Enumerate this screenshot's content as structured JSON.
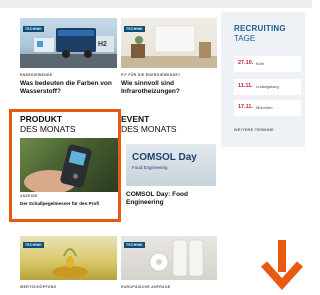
{
  "cards_top": [
    {
      "tag": "TECHNIK",
      "category": "ENERGIEWENDE",
      "title": "Was bedeuten die Farben von Wasserstoff?"
    },
    {
      "tag": "TECHNIK",
      "category": "FIT FÜR DIE ENERGIEWENDE?",
      "title": "Wie sinnvoll sind Infrarotheizungen?"
    }
  ],
  "produkt": {
    "heading": "PRODUKT",
    "subheading": "DES MONATS",
    "category": "ANZEIGE",
    "title": "Der Schallpegelmesser für den Profi"
  },
  "event": {
    "heading": "EVENT",
    "subheading": "DES MONATS",
    "banner_brand": "COMSOL Day",
    "banner_sub": "Food Engineering",
    "title": "COMSOL Day: Food Engineering"
  },
  "cards_bottom": [
    {
      "tag": "TECHNIK",
      "category": "WERTSCHÖPFUNG"
    },
    {
      "tag": "TECHNIK",
      "category": "EUROPÄISCHE ANFRAGE"
    }
  ],
  "recruiting": {
    "title": "RECRUITING",
    "subtitle": "TAGE",
    "dates": [
      {
        "day": "27.10.",
        "city": "Köln"
      },
      {
        "day": "11.11.",
        "city": "Ludwigsburg"
      },
      {
        "day": "17.11.",
        "city": "München"
      }
    ],
    "more_label": "WEITERE TERMINE"
  },
  "colors": {
    "accent_orange": "#e85a12",
    "brand_blue": "#1a5f8f",
    "date_red": "#c0262f"
  },
  "icons": {
    "scroll_indicator": "arrow-down-icon"
  }
}
